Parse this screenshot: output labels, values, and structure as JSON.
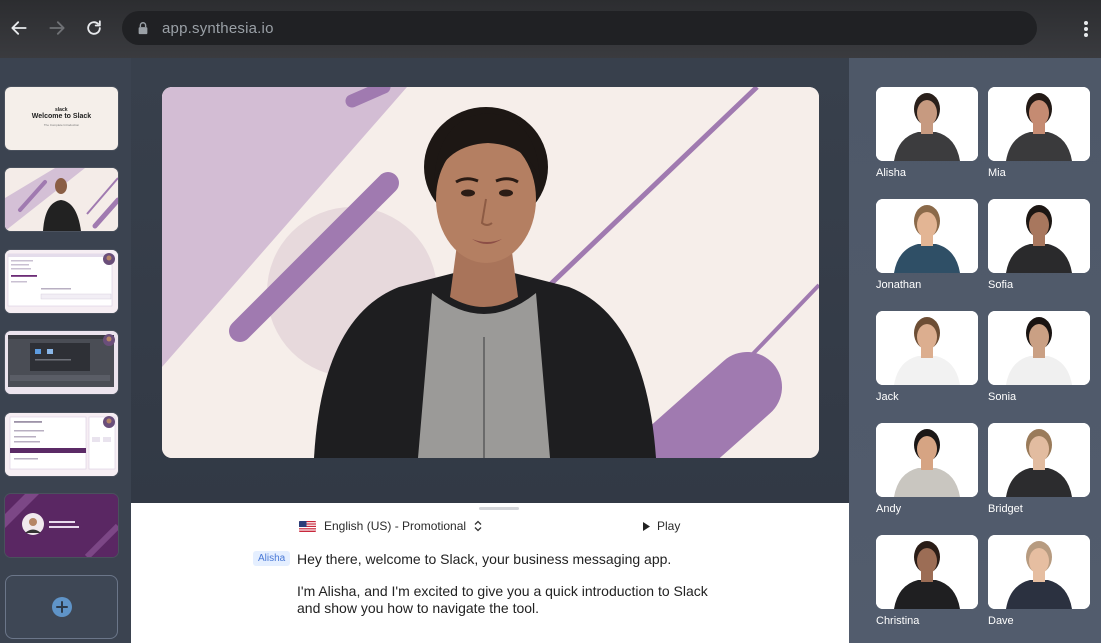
{
  "browser": {
    "url": "app.synthesia.io",
    "back_icon": "arrow-left-icon",
    "forward_icon": "arrow-right-icon",
    "reload_icon": "reload-icon",
    "menu_icon": "kebab-menu-icon"
  },
  "slides": {
    "first_slide": {
      "brand": "slack",
      "title": "Welcome to Slack",
      "subtitle": "The Complete Introduction"
    },
    "add_icon": "plus-circle-icon"
  },
  "script": {
    "language": "English (US) - Promotional",
    "play_label": "Play",
    "speaker": "Alisha",
    "first_line": "Hey there, welcome to Slack, your business messaging app.",
    "paragraph": "I'm Alisha, and I'm excited to give you a quick introduction to Slack and show you how to navigate the tool."
  },
  "avatars": [
    {
      "name": "Alisha"
    },
    {
      "name": "Mia"
    },
    {
      "name": "Jonathan"
    },
    {
      "name": "Sofia"
    },
    {
      "name": "Jack"
    },
    {
      "name": "Sonia"
    },
    {
      "name": "Andy"
    },
    {
      "name": "Bridget"
    },
    {
      "name": "Christina"
    },
    {
      "name": "Dave"
    }
  ],
  "colors": {
    "accent_purple": "#8e6a9c",
    "slide_bg": "#f6eeea",
    "chrome_bg": "#2c2d30",
    "canvas_bg": "#38404c",
    "avatar_panel_bg": "#4e5868"
  }
}
